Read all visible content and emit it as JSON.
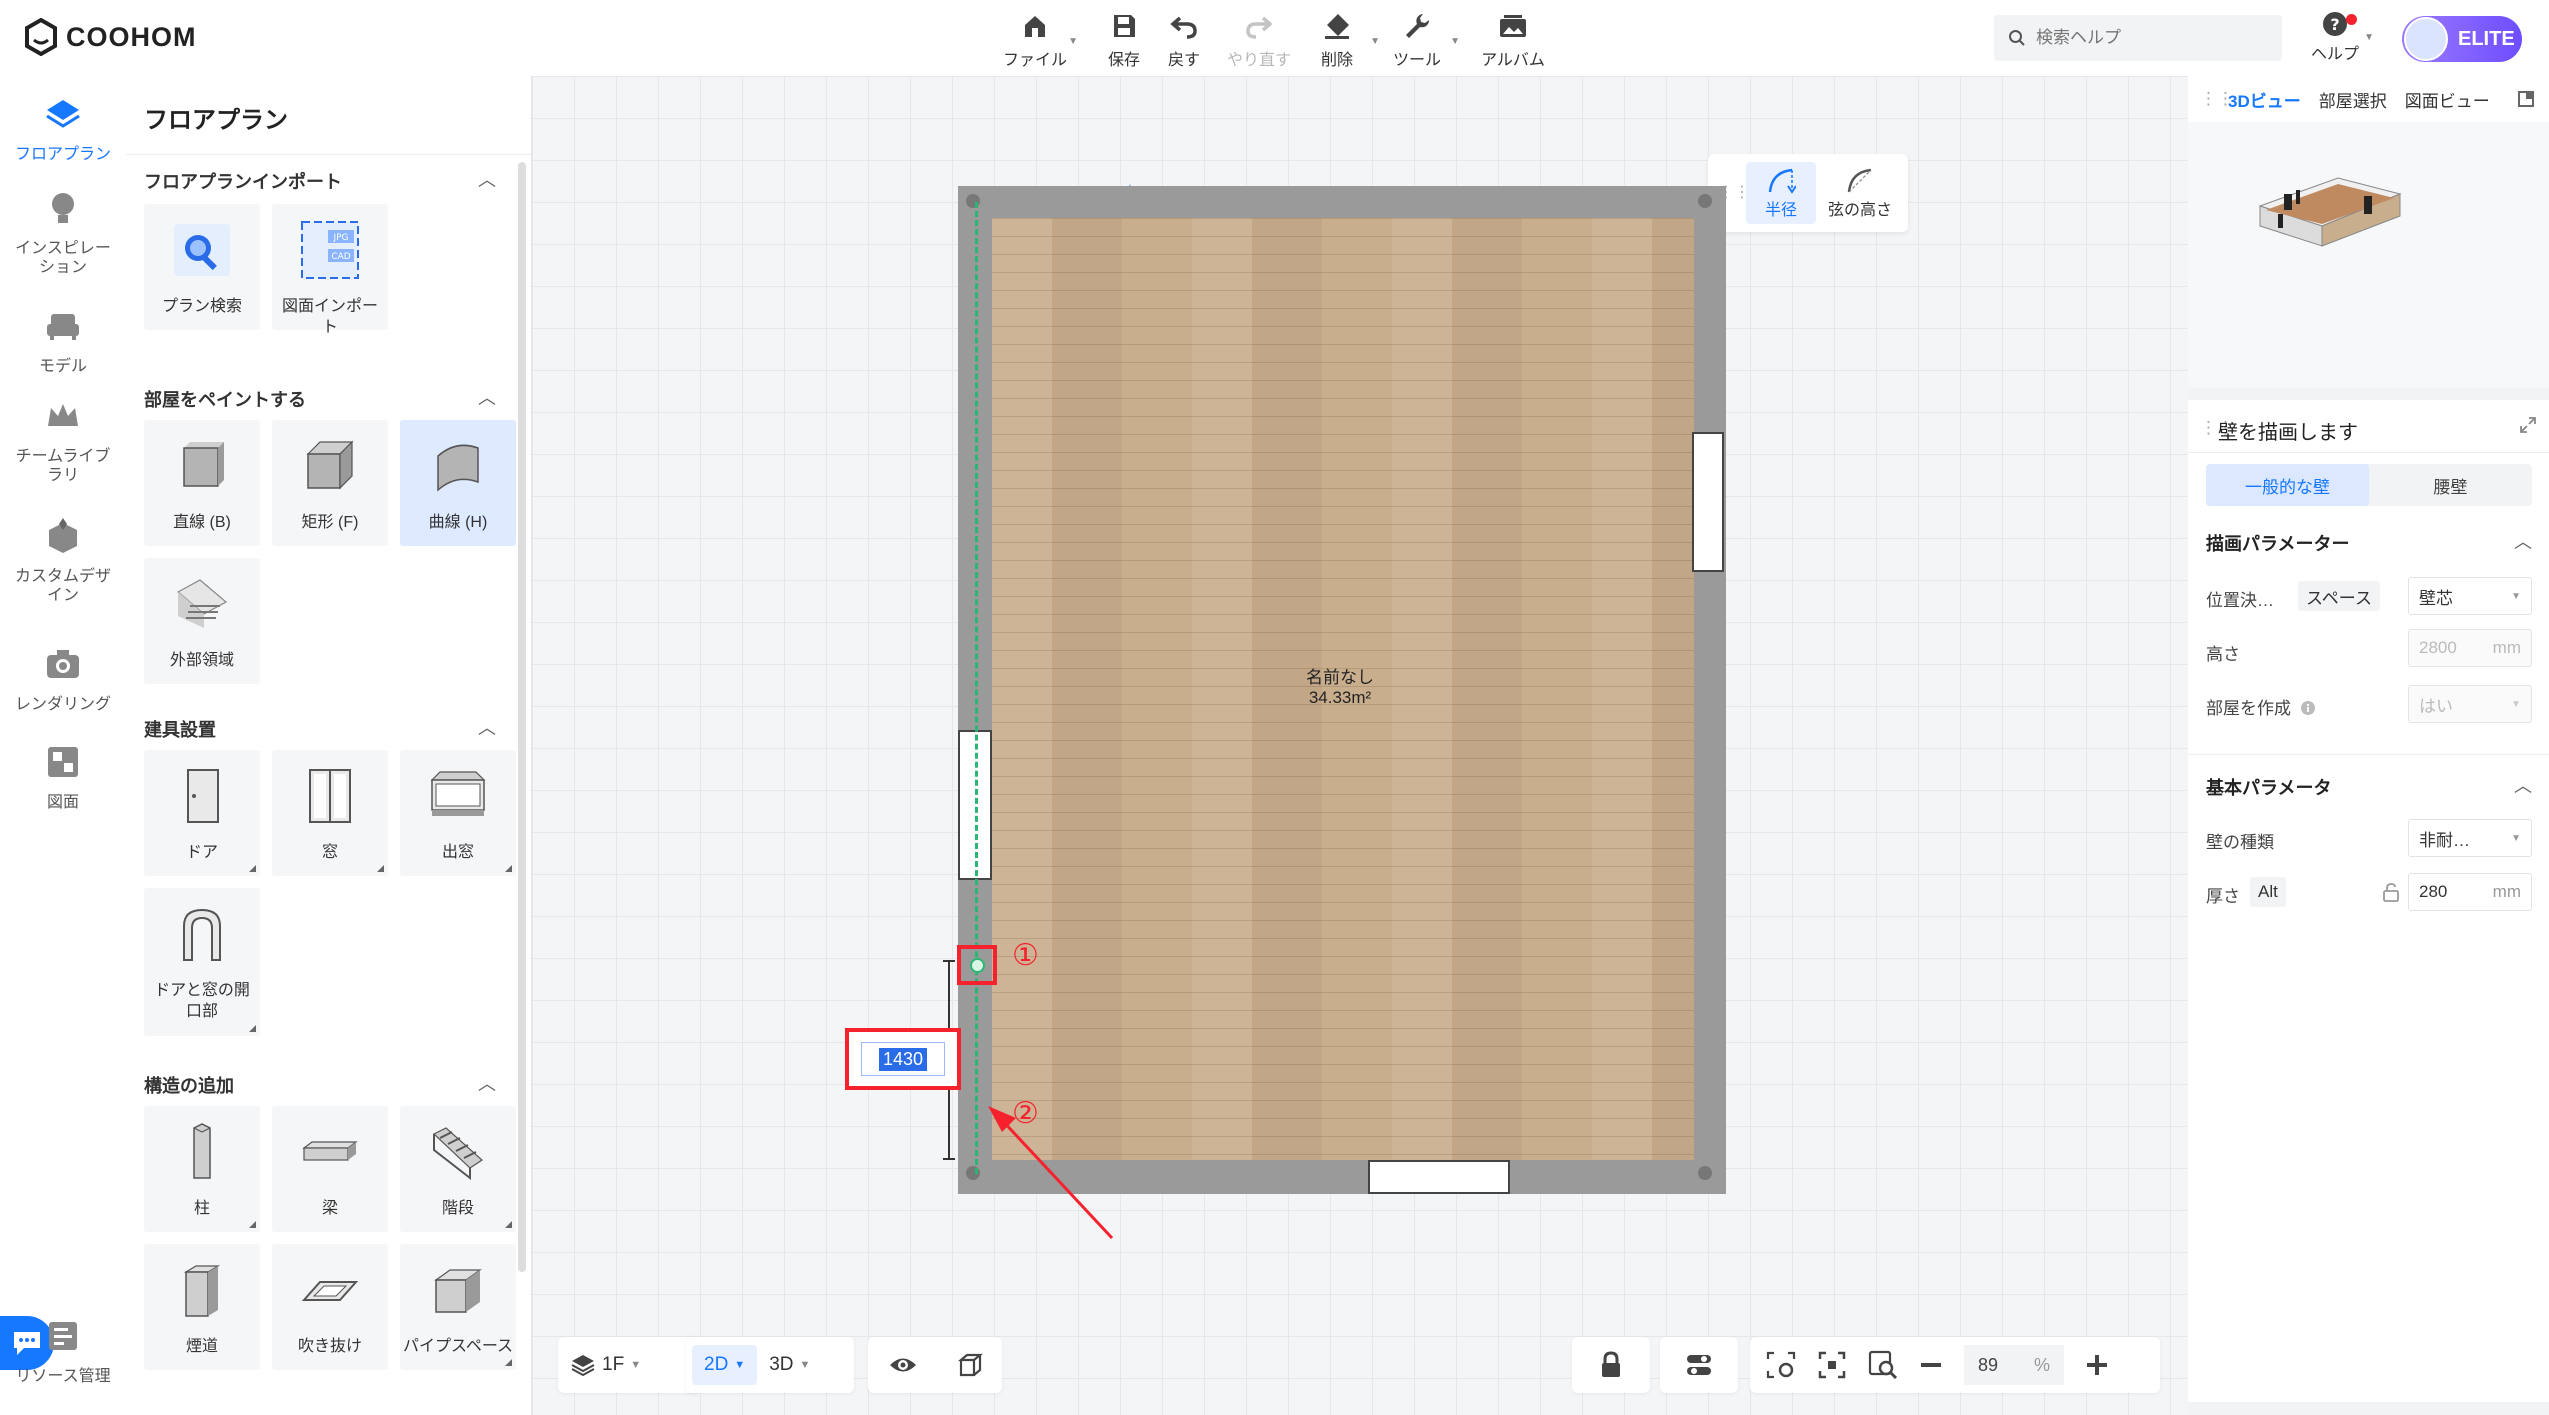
{
  "app": {
    "logo_text": "COOHOM"
  },
  "toolbar": {
    "items": [
      {
        "label": "ファイル",
        "icon": "home-icon"
      },
      {
        "label": "保存",
        "icon": "save-icon"
      },
      {
        "label": "戻す",
        "icon": "undo-icon"
      },
      {
        "label": "やり直す",
        "icon": "redo-icon",
        "disabled": true
      },
      {
        "label": "削除",
        "icon": "eraser-icon"
      },
      {
        "label": "ツール",
        "icon": "wrench-icon"
      },
      {
        "label": "アルバム",
        "icon": "album-icon"
      }
    ]
  },
  "search": {
    "placeholder": "検索ヘルプ"
  },
  "help": {
    "label": "ヘルプ"
  },
  "user": {
    "badge": "ELITE"
  },
  "rail": {
    "items": [
      {
        "label": "フロアプラン",
        "active": true
      },
      {
        "label": "インスピレーション"
      },
      {
        "label": "モデル"
      },
      {
        "label": "チームライブラリ"
      },
      {
        "label": "カスタムデザイン"
      },
      {
        "label": "レンダリング"
      },
      {
        "label": "図面"
      },
      {
        "label": "リソース管理"
      }
    ]
  },
  "panel": {
    "title": "フロアプラン",
    "sections": [
      {
        "title": "フロアプランインポート",
        "tiles": [
          "プラン検索",
          "図面インポート"
        ]
      },
      {
        "title": "部屋をペイントする",
        "tiles": [
          "直線 (B)",
          "矩形 (F)",
          "曲線 (H)",
          "外部領域"
        ]
      },
      {
        "title": "建具設置",
        "tiles": [
          "ドア",
          "窓",
          "出窓",
          "ドアと窓の開口部"
        ]
      },
      {
        "title": "構造の追加",
        "tiles": [
          "柱",
          "梁",
          "階段",
          "煙道",
          "吹き抜け",
          "パイプスペース"
        ]
      }
    ],
    "import_badges": {
      "jpg": "JPG",
      "cad": "CAD"
    }
  },
  "mini_toolbar": {
    "items": [
      {
        "label": "半径",
        "active": true
      },
      {
        "label": "弦の高さ"
      }
    ]
  },
  "room": {
    "name": "名前なし",
    "area": "34.33m²"
  },
  "annotations": {
    "dimension_value": "1430",
    "marker1": "①",
    "marker2": "②"
  },
  "bottom": {
    "floor": "1F",
    "view2d": "2D",
    "view3d": "3D",
    "zoom": "89",
    "zoom_unit": "%"
  },
  "view_panel": {
    "tabs": [
      "3Dビュー",
      "部屋選択",
      "図面ビュー"
    ]
  },
  "props": {
    "title": "壁を描画します",
    "tabs": [
      "一般的な壁",
      "腰壁"
    ],
    "draw_section": "描画パラメーター",
    "position_label": "位置決…",
    "position_chip": "スペース",
    "position_value": "壁芯",
    "height_label": "高さ",
    "height_value": "2800",
    "height_unit": "mm",
    "create_room_label": "部屋を作成",
    "create_room_value": "はい",
    "basic_section": "基本パラメータ",
    "wall_type_label": "壁の種類",
    "wall_type_value": "非耐…",
    "thickness_label": "厚さ",
    "thickness_chip": "Alt",
    "thickness_value": "280",
    "thickness_unit": "mm"
  },
  "colors": {
    "accent": "#1677ff",
    "annotation_red": "#f5222d",
    "guide_green": "#2bb673",
    "wall_gray": "#9a9a9a"
  }
}
